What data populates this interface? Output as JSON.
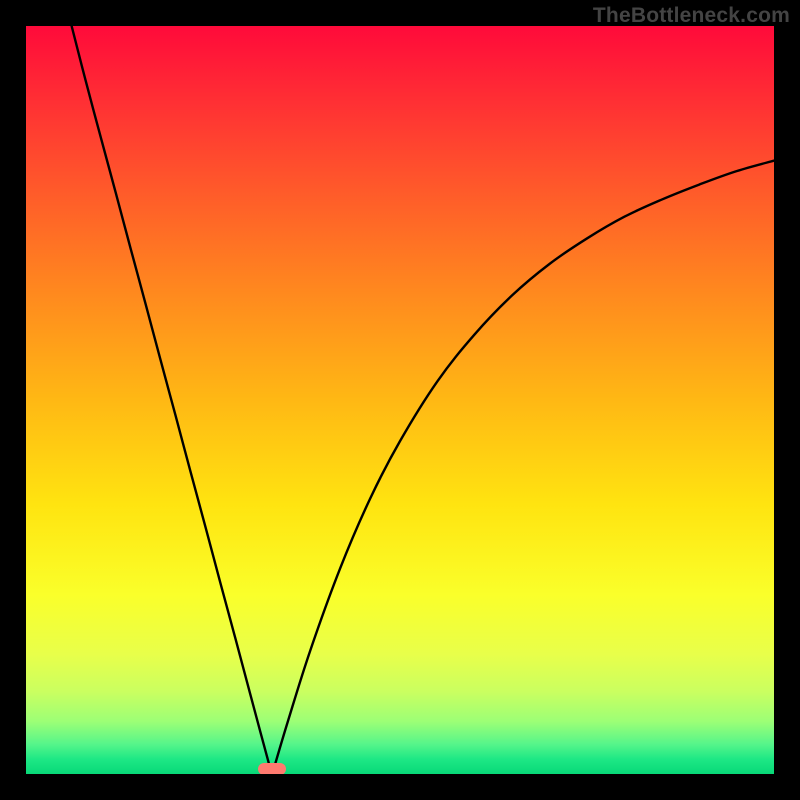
{
  "watermark": "TheBottleneck.com",
  "colors": {
    "frame": "#000000",
    "curve": "#000000",
    "marker": "#ff7a6f",
    "gradient_top": "#ff0a3a",
    "gradient_bottom": "#08d878"
  },
  "chart_data": {
    "type": "line",
    "title": "",
    "xlabel": "",
    "ylabel": "",
    "xlim": [
      0,
      100
    ],
    "ylim": [
      0,
      100
    ],
    "grid": false,
    "legend": false,
    "annotations": [
      {
        "text": "TheBottleneck.com",
        "x": 100,
        "y": 100,
        "anchor": "top-right"
      }
    ],
    "series": [
      {
        "name": "left-branch",
        "x": [
          6.1,
          8,
          10,
          12,
          14,
          16,
          18,
          20,
          22,
          24,
          26,
          28,
          30,
          31.5,
          32.5
        ],
        "y": [
          100,
          92.6,
          85.1,
          77.7,
          70.2,
          62.8,
          55.3,
          47.9,
          40.4,
          33.0,
          25.5,
          18.1,
          10.6,
          5.0,
          1.3
        ]
      },
      {
        "name": "right-branch",
        "x": [
          33.3,
          35,
          38,
          42,
          46,
          50,
          55,
          60,
          65,
          70,
          75,
          80,
          85,
          90,
          95,
          100
        ],
        "y": [
          1.3,
          7.0,
          16.5,
          27.5,
          36.8,
          44.5,
          52.5,
          58.8,
          64.0,
          68.2,
          71.6,
          74.5,
          76.8,
          78.8,
          80.6,
          82.0
        ]
      }
    ],
    "marker": {
      "x": 32.9,
      "y": 0.7
    }
  }
}
